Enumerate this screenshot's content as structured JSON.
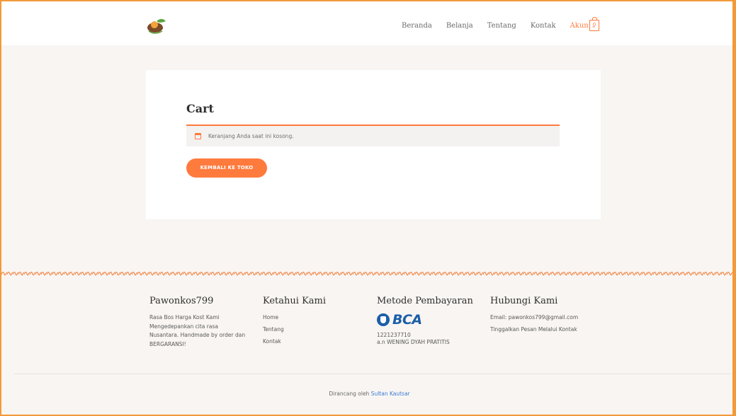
{
  "header": {
    "nav": [
      {
        "label": "Beranda"
      },
      {
        "label": "Belanja"
      },
      {
        "label": "Tentang"
      },
      {
        "label": "Kontak"
      },
      {
        "label": "Akun"
      }
    ],
    "cart_count": "0"
  },
  "main": {
    "title": "Cart",
    "notice": "Keranjang Anda saat ini kosong.",
    "back_button": "KEMBALI KE TOKO"
  },
  "footer": {
    "about": {
      "title": "Pawonkos799",
      "text": "Rasa Bos Harga Kost Kami Mengedepankan cita rasa Nusantara. Handmade by order dan BERGARANSI!"
    },
    "links": {
      "title": "Ketahui Kami",
      "items": [
        "Home",
        "Tentang",
        "Kontak"
      ]
    },
    "payment": {
      "title": "Metode Pembayaran",
      "bank": "BCA",
      "account": "1221237710",
      "holder": "a.n WENING DYAH PRATITIS"
    },
    "contact": {
      "title": "Hubungi Kami",
      "email": "Email: pawonkos799@gmail.com",
      "message": "Tinggalkan Pesan Melalui Kontak"
    },
    "credit_prefix": "Dirancang oleh",
    "credit_author": "Sultan Kautsar"
  },
  "colors": {
    "accent": "#ff7a3d",
    "border": "#f29a3a",
    "background": "#f8f5f2",
    "bca_blue": "#1b5ea8"
  },
  "icons": [
    "logo-icon",
    "cart-icon",
    "chevron-down-icon",
    "calendar-icon",
    "bca-logo-icon"
  ]
}
